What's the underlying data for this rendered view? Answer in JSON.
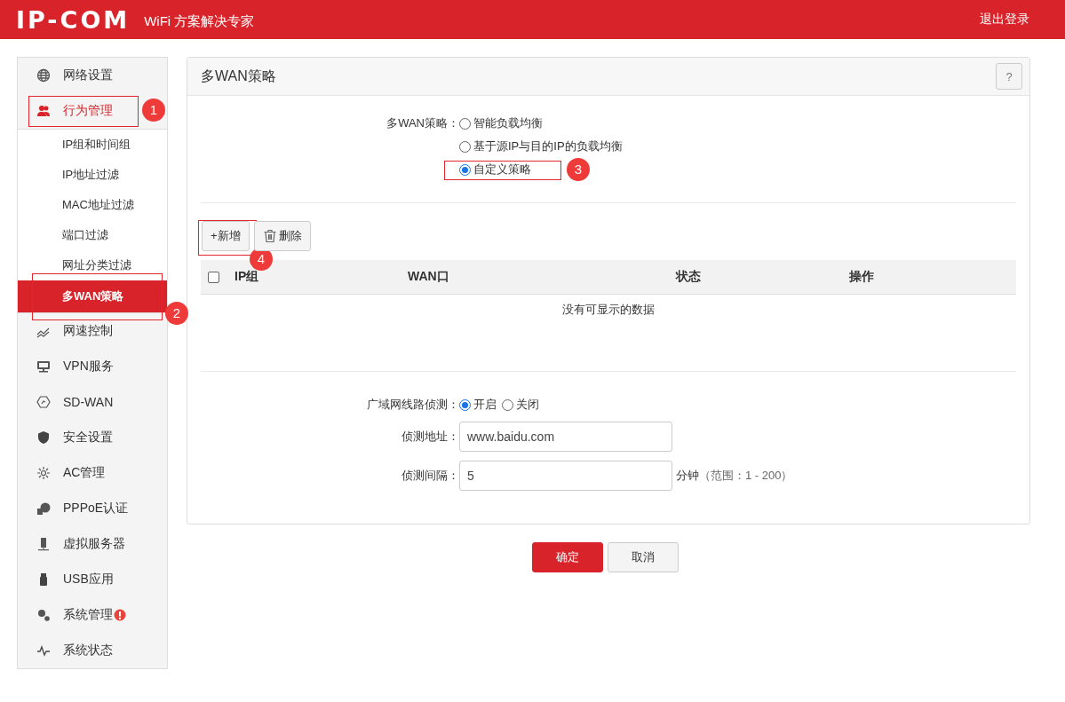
{
  "header": {
    "logo": "IP-COM",
    "tagline": "WiFi 方案解决专家",
    "logout": "退出登录"
  },
  "sidebar": {
    "items": [
      {
        "label": "网络设置",
        "selected": false,
        "alert": false
      },
      {
        "label": "行为管理",
        "selected": true,
        "alert": false,
        "annotation": "1",
        "children": [
          {
            "label": "IP组和时间组",
            "selected": false
          },
          {
            "label": "IP地址过滤",
            "selected": false
          },
          {
            "label": "MAC地址过滤",
            "selected": false
          },
          {
            "label": "端口过滤",
            "selected": false
          },
          {
            "label": "网址分类过滤",
            "selected": false
          },
          {
            "label": "多WAN策略",
            "selected": true,
            "annotation": "2"
          }
        ]
      },
      {
        "label": "网速控制",
        "selected": false,
        "alert": false
      },
      {
        "label": "VPN服务",
        "selected": false,
        "alert": false
      },
      {
        "label": "SD-WAN",
        "selected": false,
        "alert": false
      },
      {
        "label": "安全设置",
        "selected": false,
        "alert": false
      },
      {
        "label": "AC管理",
        "selected": false,
        "alert": false
      },
      {
        "label": "PPPoE认证",
        "selected": false,
        "alert": false
      },
      {
        "label": "虚拟服务器",
        "selected": false,
        "alert": false
      },
      {
        "label": "USB应用",
        "selected": false,
        "alert": false
      },
      {
        "label": "系统管理",
        "selected": false,
        "alert": true
      },
      {
        "label": "系统状态",
        "selected": false,
        "alert": false
      }
    ]
  },
  "panel": {
    "title": "多WAN策略",
    "help": "?",
    "strategy": {
      "label": "多WAN策略：",
      "options": [
        {
          "label": "智能负载均衡",
          "selected": false
        },
        {
          "label": "基于源IP与目的IP的负载均衡",
          "selected": false
        },
        {
          "label": "自定义策略",
          "selected": true,
          "annotation": "3"
        }
      ]
    },
    "toolbar": [
      {
        "label": "+新增",
        "kind": "add",
        "annotation": "4"
      },
      {
        "label": "删除",
        "kind": "delete"
      }
    ],
    "table": {
      "select_all_checked": false,
      "columns": [
        "IP组",
        "WAN口",
        "状态",
        "操作"
      ],
      "empty": "没有可显示的数据"
    },
    "detect": {
      "label": "广域网线路侦测：",
      "options": [
        {
          "label": "开启",
          "selected": true
        },
        {
          "label": "关闭",
          "selected": false
        }
      ]
    },
    "fields": [
      {
        "label": "侦测地址：",
        "value": "www.baidu.com"
      },
      {
        "label": "侦测间隔：",
        "value": "5",
        "unit": "分钟",
        "hint": "（范围：1 - 200）"
      }
    ]
  },
  "actions": [
    {
      "label": "确定",
      "kind": "primary"
    },
    {
      "label": "取消",
      "kind": "secondary"
    }
  ]
}
